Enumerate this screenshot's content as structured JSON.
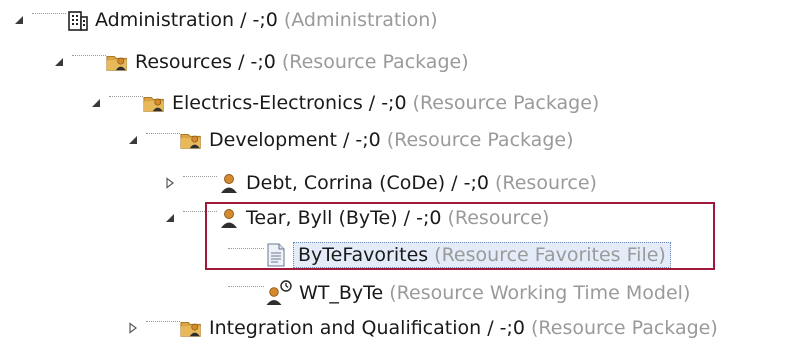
{
  "tree": {
    "nodes": [
      {
        "id": "administration",
        "name": "Administration / -;0",
        "type": "(Administration)",
        "icon": "building-icon",
        "expander": "expanded",
        "level": 0
      },
      {
        "id": "resources",
        "name": "Resources / -;0",
        "type": "(Resource Package)",
        "icon": "folder-person-icon",
        "expander": "expanded",
        "level": 1
      },
      {
        "id": "electrics-electronics",
        "name": "Electrics-Electronics / -;0",
        "type": "(Resource Package)",
        "icon": "folder-person-icon",
        "expander": "expanded",
        "level": 2
      },
      {
        "id": "development",
        "name": "Development / -;0",
        "type": "(Resource Package)",
        "icon": "folder-person-icon",
        "expander": "expanded",
        "level": 3
      },
      {
        "id": "debt-corrina",
        "name": "Debt, Corrina (CoDe) / -;0",
        "type": "(Resource)",
        "icon": "person-icon",
        "expander": "collapsed",
        "level": 4
      },
      {
        "id": "tear-byll",
        "name": "Tear, Byll (ByTe) / -;0",
        "type": "(Resource)",
        "icon": "person-icon",
        "expander": "expanded",
        "level": 4
      },
      {
        "id": "bytefavorites",
        "name": "ByTeFavorites",
        "type": "(Resource Favorites File)",
        "icon": "document-icon",
        "expander": "none",
        "level": 5,
        "selected": true
      },
      {
        "id": "wt-byte",
        "name": "WT_ByTe",
        "type": "(Resource Working Time Model)",
        "icon": "person-clock-icon",
        "expander": "none",
        "level": 5
      },
      {
        "id": "integration-qualification",
        "name": "Integration and Qualification / -;0",
        "type": "(Resource Package)",
        "icon": "folder-person-icon",
        "expander": "collapsed",
        "level": 3
      }
    ]
  },
  "colors": {
    "highlight_border": "#a0183a",
    "selection_background": "#e3ecf8",
    "selection_border": "#6b88b3",
    "type_text": "#9a9a9a",
    "name_text": "#1a1a1a",
    "folder": "#d9a441",
    "person": "#d68a2e"
  }
}
